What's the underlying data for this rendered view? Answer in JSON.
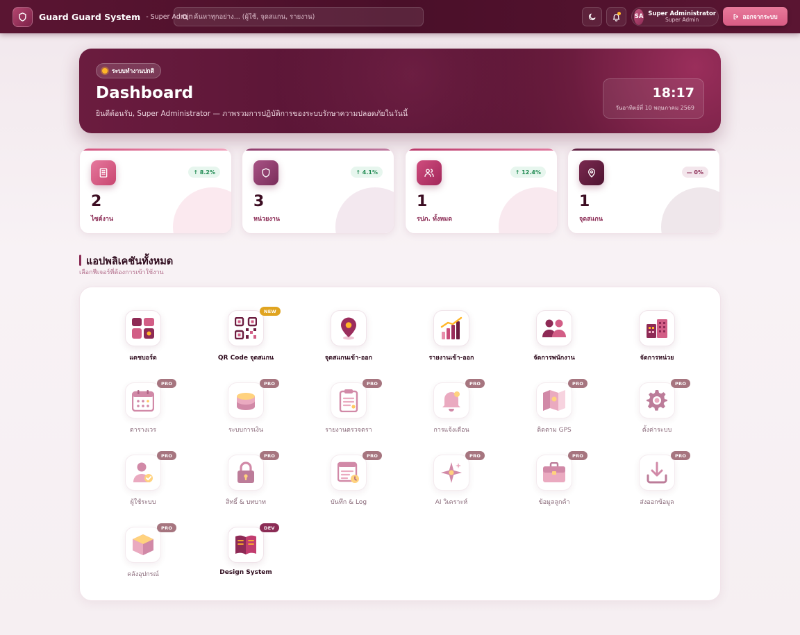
{
  "topbar": {
    "brand_name": "Guard Guard System",
    "brand_role": "- Super Admin",
    "search_placeholder": "ค้นหาทุกอย่าง... (ผู้ใช้, จุดสแกน, รายงาน)",
    "user_initials": "SA",
    "user_name": "Super Administrator",
    "user_role": "Super Admin",
    "logout_label": "ออกจากระบบ",
    "icons": [
      "shield-icon",
      "search-icon",
      "moon-icon",
      "bell-icon",
      "logout-icon"
    ]
  },
  "hero": {
    "status": "ระบบทำงานปกติ",
    "title": "Dashboard",
    "subtitle": "ยินดีต้อนรับ, Super Administrator — ภาพรวมการปฏิบัติการของระบบรักษาความปลอดภัยในวันนี้",
    "time": "18:17",
    "date": "วันอาทิตย์ที่ 10 พฤษภาคม 2569"
  },
  "stats": [
    {
      "value": "2",
      "label": "ไซต์งาน",
      "trend": "↑ 8.2%",
      "icon": "building-icon",
      "color": "#d2527e"
    },
    {
      "value": "3",
      "label": "หน่วยงาน",
      "trend": "↑ 4.1%",
      "icon": "shield-icon",
      "color": "#8e3a6b"
    },
    {
      "value": "1",
      "label": "รปภ. ทั้งหมด",
      "trend": "↑ 12.4%",
      "icon": "users-icon",
      "color": "#b83466"
    },
    {
      "value": "1",
      "label": "จุดสแกน",
      "trend": "— 0%",
      "icon": "map-pin-icon",
      "color": "#5a1a3c"
    }
  ],
  "section": {
    "title": "แอปพลิเคชันทั้งหมด",
    "subtitle": "เลือกฟีเจอร์ที่ต้องการเข้าใช้งาน"
  },
  "apps": [
    {
      "label": "แดชบอร์ด",
      "badge": "",
      "icon": "dashboard-icon"
    },
    {
      "label": "QR Code จุดสแกน",
      "badge": "NEW",
      "icon": "qr-code-icon"
    },
    {
      "label": "จุดสแกนเข้า-ออก",
      "badge": "",
      "icon": "location-pin-icon"
    },
    {
      "label": "รายงานเข้า-ออก",
      "badge": "",
      "icon": "bar-chart-icon"
    },
    {
      "label": "จัดการพนักงาน",
      "badge": "",
      "icon": "team-icon"
    },
    {
      "label": "จัดการหน่วย",
      "badge": "",
      "icon": "buildings-icon"
    },
    {
      "label": "ตารางเวร",
      "badge": "PRO",
      "icon": "calendar-icon"
    },
    {
      "label": "ระบบการเงิน",
      "badge": "PRO",
      "icon": "coins-icon"
    },
    {
      "label": "รายงานตรวจตรา",
      "badge": "PRO",
      "icon": "clipboard-icon"
    },
    {
      "label": "การแจ้งเตือน",
      "badge": "PRO",
      "icon": "bell-icon"
    },
    {
      "label": "ติดตาม GPS",
      "badge": "PRO",
      "icon": "map-icon"
    },
    {
      "label": "ตั้งค่าระบบ",
      "badge": "PRO",
      "icon": "gear-icon"
    },
    {
      "label": "ผู้ใช้ระบบ",
      "badge": "PRO",
      "icon": "user-check-icon"
    },
    {
      "label": "สิทธิ์ & บทบาท",
      "badge": "PRO",
      "icon": "lock-icon"
    },
    {
      "label": "บันทึก & Log",
      "badge": "PRO",
      "icon": "log-icon"
    },
    {
      "label": "AI วิเคราะห์",
      "badge": "PRO",
      "icon": "sparkle-icon"
    },
    {
      "label": "ข้อมูลลูกค้า",
      "badge": "PRO",
      "icon": "briefcase-icon"
    },
    {
      "label": "ส่งออกข้อมูล",
      "badge": "PRO",
      "icon": "download-icon"
    },
    {
      "label": "คลังอุปกรณ์",
      "badge": "PRO",
      "icon": "box-icon"
    },
    {
      "label": "Design System",
      "badge": "DEV",
      "icon": "book-icon"
    }
  ]
}
